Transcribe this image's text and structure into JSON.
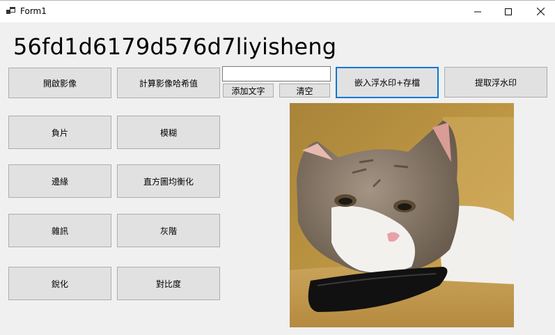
{
  "window": {
    "title": "Form1"
  },
  "label": {
    "text": "56fd1d6179d576d7liyisheng"
  },
  "buttons": {
    "open_image": "開啟影像",
    "compute_hash": "計算影像哈希值",
    "add_text": "添加文字",
    "clear": "清空",
    "embed_watermark": "嵌入浮水印+存檔",
    "extract_watermark": "提取浮水印",
    "negative": "負片",
    "blur": "模糊",
    "edge": "邊緣",
    "histogram_equalization": "直方圖均衡化",
    "noise": "雜訊",
    "grayscale": "灰階",
    "sharpen": "銳化",
    "contrast": "對比度"
  },
  "textbox": {
    "value": ""
  },
  "picture": {
    "subject": "cat resting head on smartphone"
  },
  "colors": {
    "focus": "#0078d7",
    "button_bg": "#e1e1e1",
    "form_bg": "#f0f0f0"
  }
}
